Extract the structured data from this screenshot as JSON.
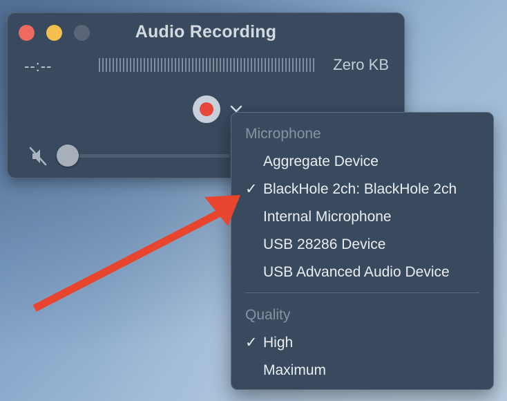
{
  "window": {
    "title": "Audio Recording",
    "elapsed_time": "--:--",
    "file_size": "Zero KB",
    "volume_level": 0
  },
  "menu": {
    "sections": [
      {
        "heading": "Microphone",
        "items": [
          {
            "label": "Aggregate Device",
            "checked": false
          },
          {
            "label": "BlackHole 2ch: BlackHole 2ch",
            "checked": true
          },
          {
            "label": "Internal Microphone",
            "checked": false
          },
          {
            "label": "USB 28286 Device",
            "checked": false
          },
          {
            "label": "USB Advanced Audio Device",
            "checked": false
          }
        ]
      },
      {
        "heading": "Quality",
        "items": [
          {
            "label": "High",
            "checked": true
          },
          {
            "label": "Maximum",
            "checked": false
          }
        ]
      }
    ],
    "check_glyph": "✓"
  },
  "icons": {
    "close": "close-button",
    "minimize": "minimize-button",
    "zoom": "zoom-button",
    "record": "record-icon",
    "chevron": "chevron-down-icon",
    "mute": "speaker-mute-icon",
    "annotation": "red-arrow-icon"
  },
  "colors": {
    "window_bg": "#394a5f",
    "menu_bg": "#3a4a5e",
    "record_red": "#e7473a",
    "arrow_red": "#e8452f",
    "close": "#ee6a5f",
    "minimize": "#f4bf4f"
  }
}
